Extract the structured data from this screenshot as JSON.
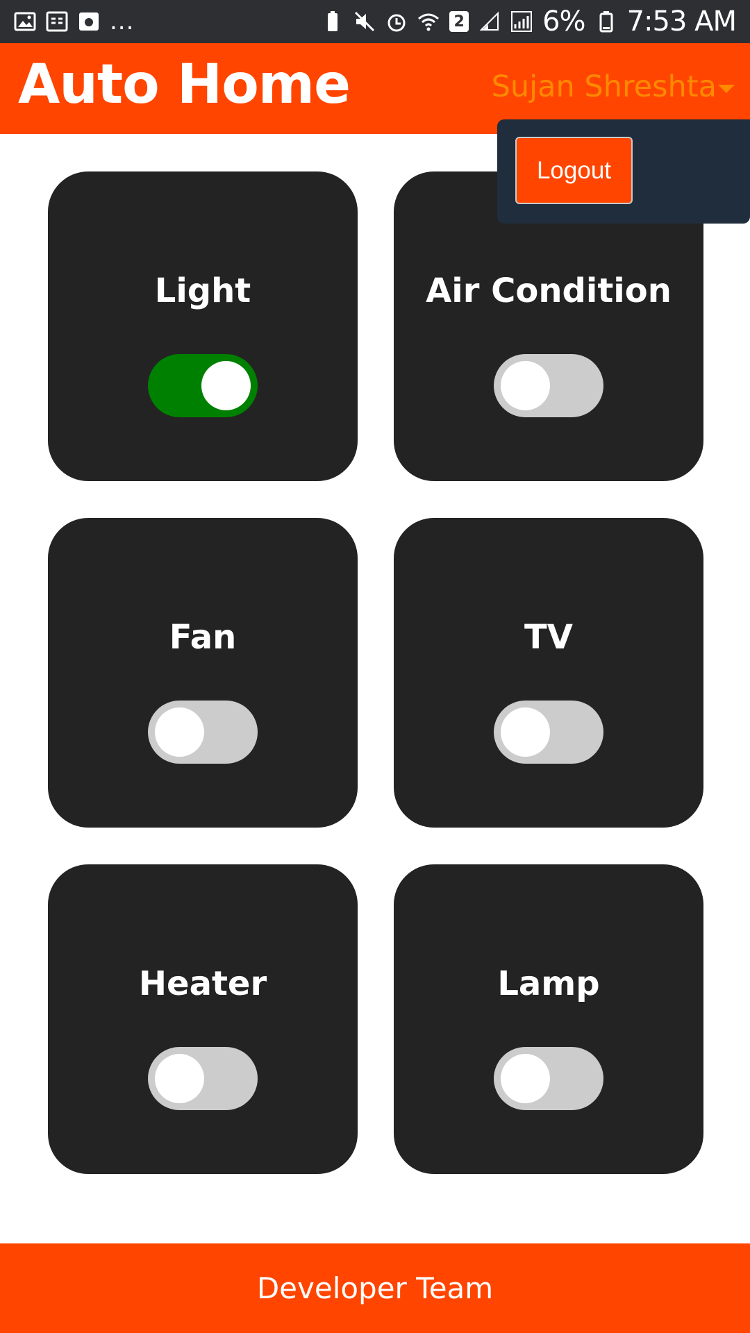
{
  "status_bar": {
    "notification_icons": [
      "image-icon",
      "calendar-icon",
      "app-icon"
    ],
    "overflow": "...",
    "system_icons": [
      "battery-saver-icon",
      "mute-icon",
      "alarm-icon",
      "wifi-icon",
      "sim-icon",
      "signal-icon",
      "signal-icon"
    ],
    "sim_badge": "2",
    "battery_percent": "6%",
    "time": "7:53 AM"
  },
  "header": {
    "title": "Auto Home",
    "user_name": "Sujan Shreshta"
  },
  "dropdown": {
    "logout_label": "Logout"
  },
  "devices": [
    {
      "name": "Light",
      "on": true
    },
    {
      "name": "Air Condition",
      "on": false
    },
    {
      "name": "Fan",
      "on": false
    },
    {
      "name": "TV",
      "on": false
    },
    {
      "name": "Heater",
      "on": false
    },
    {
      "name": "Lamp",
      "on": false
    }
  ],
  "footer": {
    "text": "Developer Team"
  },
  "colors": {
    "brand": "#ff4500",
    "user_name": "#ff8a00",
    "card": "#232323",
    "toggle_on": "#008000",
    "toggle_off": "#cccccc",
    "dropdown": "#1f2d3d"
  }
}
